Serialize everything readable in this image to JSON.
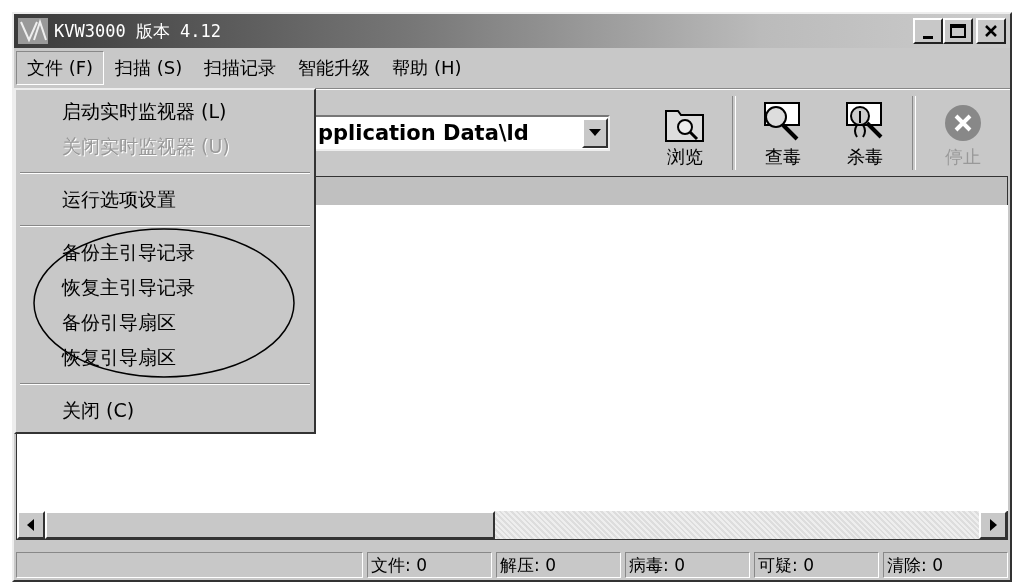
{
  "window": {
    "title": "KVW3000 版本 4.12"
  },
  "menu_bar": [
    {
      "label": "文件 (F)",
      "selected": true
    },
    {
      "label": "扫描 (S)",
      "selected": false
    },
    {
      "label": "扫描记录",
      "selected": false
    },
    {
      "label": "智能升级",
      "selected": false
    },
    {
      "label": "帮助 (H)",
      "selected": false
    }
  ],
  "file_menu": {
    "items": [
      {
        "kind": "item",
        "label": "启动实时监视器 (L)",
        "disabled": false
      },
      {
        "kind": "item",
        "label": "关闭实时监视器 (U)",
        "disabled": true
      },
      {
        "kind": "separator"
      },
      {
        "kind": "item",
        "label": "运行选项设置",
        "disabled": false
      },
      {
        "kind": "separator"
      },
      {
        "kind": "item",
        "label": "备份主引导记录",
        "disabled": false,
        "circled": true
      },
      {
        "kind": "item",
        "label": "恢复主引导记录",
        "disabled": false,
        "circled": true
      },
      {
        "kind": "item",
        "label": "备份引导扇区",
        "disabled": false,
        "circled": true
      },
      {
        "kind": "item",
        "label": "恢复引导扇区",
        "disabled": false,
        "circled": true
      },
      {
        "kind": "separator"
      },
      {
        "kind": "item",
        "label": "关闭 (C)",
        "disabled": false
      }
    ]
  },
  "path_combo": {
    "value": "pplication Data\\ld"
  },
  "toolbar": [
    {
      "kind": "browse",
      "label": "浏览",
      "disabled": false
    },
    {
      "kind": "separator"
    },
    {
      "kind": "scan",
      "label": "查毒",
      "disabled": false
    },
    {
      "kind": "kill",
      "label": "杀毒",
      "disabled": false
    },
    {
      "kind": "separator"
    },
    {
      "kind": "stop",
      "label": "停止",
      "disabled": true
    }
  ],
  "status_bar": [
    "文件: 0",
    "解压: 0",
    "病毒: 0",
    "可疑: 0",
    "清除: 0"
  ]
}
